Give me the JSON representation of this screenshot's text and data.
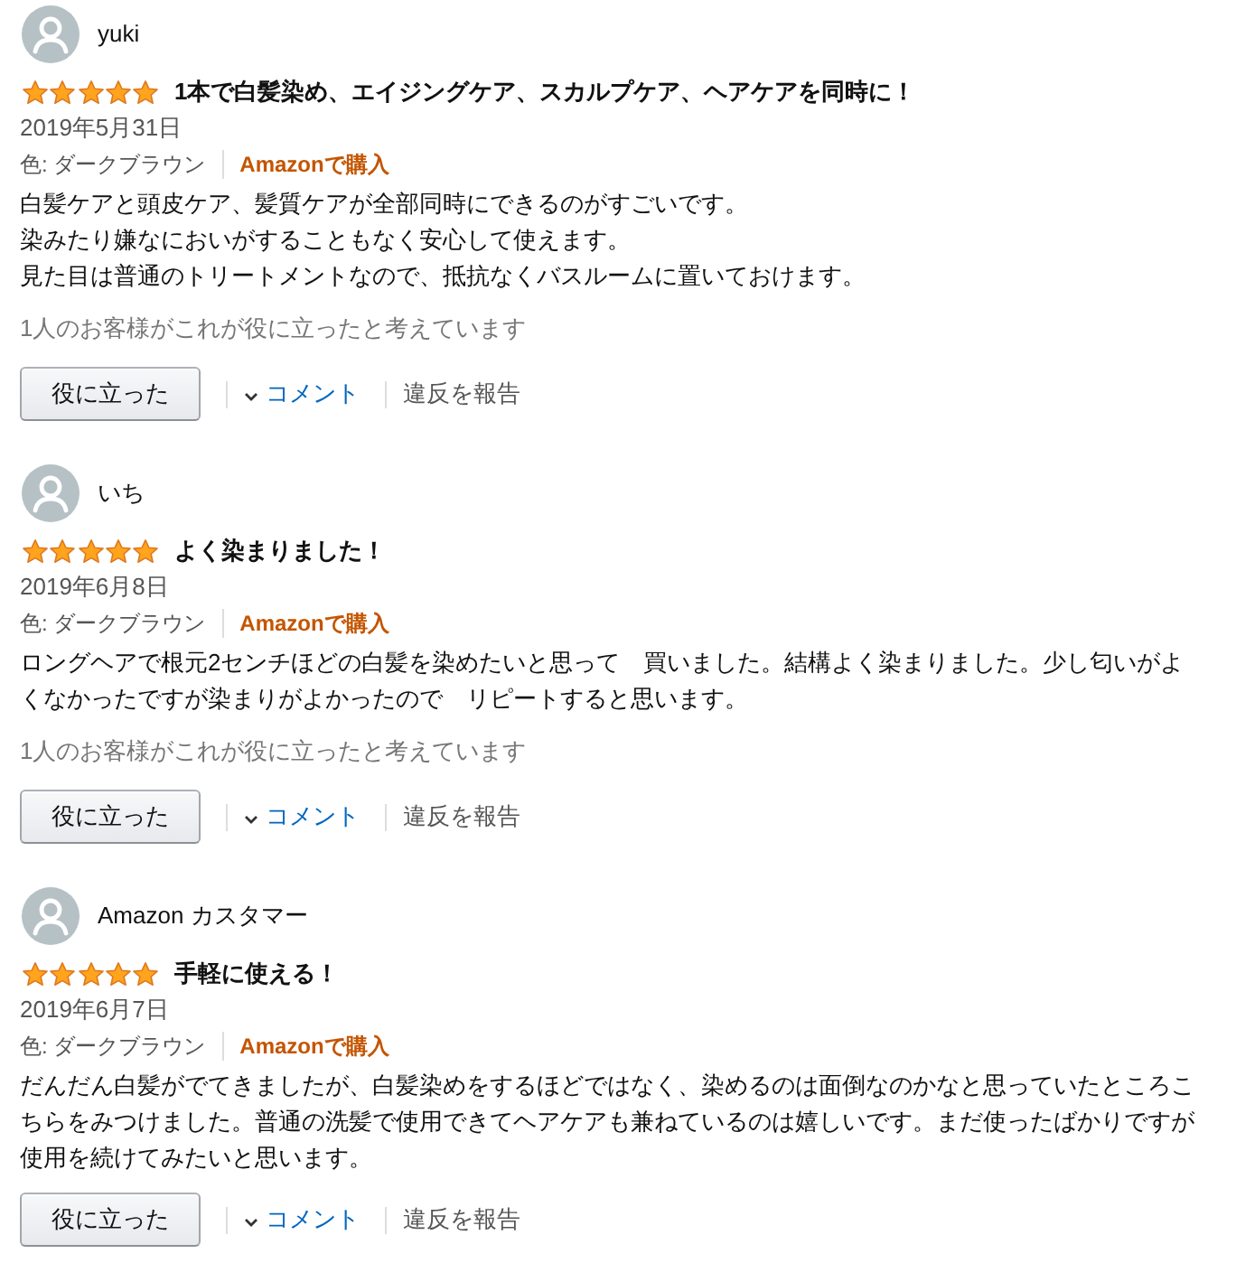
{
  "reviews": [
    {
      "author": "yuki",
      "stars": 5,
      "title": "1本で白髪染め、エイジングケア、スカルプケア、ヘアケアを同時に！",
      "date": "2019年5月31日",
      "variant": "色: ダークブラウン",
      "purchase": "Amazonで購入",
      "body": [
        "白髪ケアと頭皮ケア、髪質ケアが全部同時にできるのがすごいです。",
        "染みたり嫌なにおいがすることもなく安心して使えます。",
        "見た目は普通のトリートメントなので、抵抗なくバスルームに置いておけます。"
      ],
      "helpful_count": "1人のお客様がこれが役に立ったと考えています",
      "helpful_button": "役に立った",
      "comment_link": "コメント",
      "report_link": "違反を報告"
    },
    {
      "author": "いち",
      "stars": 5,
      "title": "よく染まりました！",
      "date": "2019年6月8日",
      "variant": "色: ダークブラウン",
      "purchase": "Amazonで購入",
      "body": [
        "ロングヘアで根元2センチほどの白髪を染めたいと思って　買いました。結構よく染まりました。少し匂いがよくなかったですが染まりがよかったので　リピートすると思います。"
      ],
      "helpful_count": "1人のお客様がこれが役に立ったと考えています",
      "helpful_button": "役に立った",
      "comment_link": "コメント",
      "report_link": "違反を報告"
    },
    {
      "author": "Amazon カスタマー",
      "stars": 5,
      "title": "手軽に使える！",
      "date": "2019年6月7日",
      "variant": "色: ダークブラウン",
      "purchase": "Amazonで購入",
      "body": [
        "だんだん白髪がでてきましたが、白髪染めをするほどではなく、染めるのは面倒なのかなと思っていたところこちらをみつけました。普通の洗髪で使用できてヘアケアも兼ねているのは嬉しいです。まだ使ったばかりですが使用を続けてみたいと思います。"
      ],
      "helpful_button": "役に立った",
      "comment_link": "コメント",
      "report_link": "違反を報告"
    }
  ]
}
